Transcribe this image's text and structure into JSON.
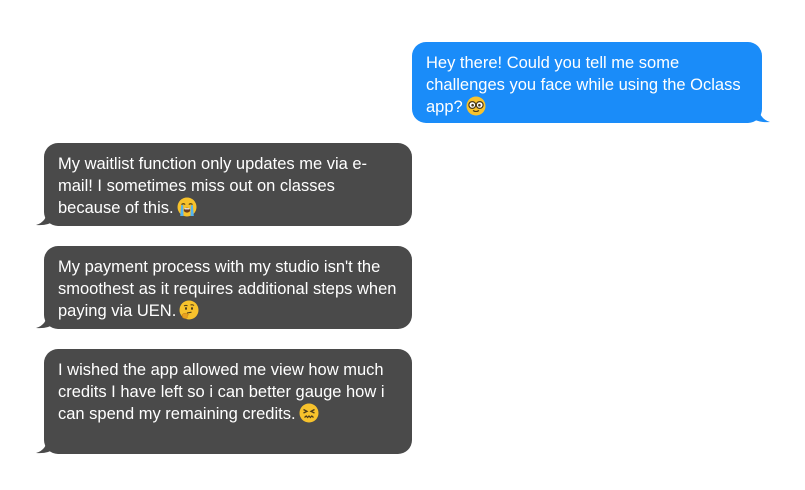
{
  "conversation": {
    "messages": [
      {
        "sender": "me",
        "text": "Hey there! Could you tell me some challenges you face while using the Oclass app?",
        "emoji": "nerd-face-emoji"
      },
      {
        "sender": "them",
        "text": "My waitlist function only updates me via e-mail! I sometimes miss out on classes because of this.",
        "emoji": "loudly-crying-face-emoji"
      },
      {
        "sender": "them",
        "text": "My payment process with my studio isn't the smoothest as it requires additional steps when paying via UEN.",
        "emoji": "thinking-face-emoji"
      },
      {
        "sender": "them",
        "text": "I wished the app allowed me view how much credits I have left so i can better gauge how i can spend my remaining credits.",
        "emoji": "confounded-face-emoji"
      }
    ]
  },
  "colors": {
    "sent_bubble": "#1a8cf9",
    "received_bubble": "#4a4a4a",
    "bubble_text": "#ffffff",
    "background": "#ffffff"
  }
}
